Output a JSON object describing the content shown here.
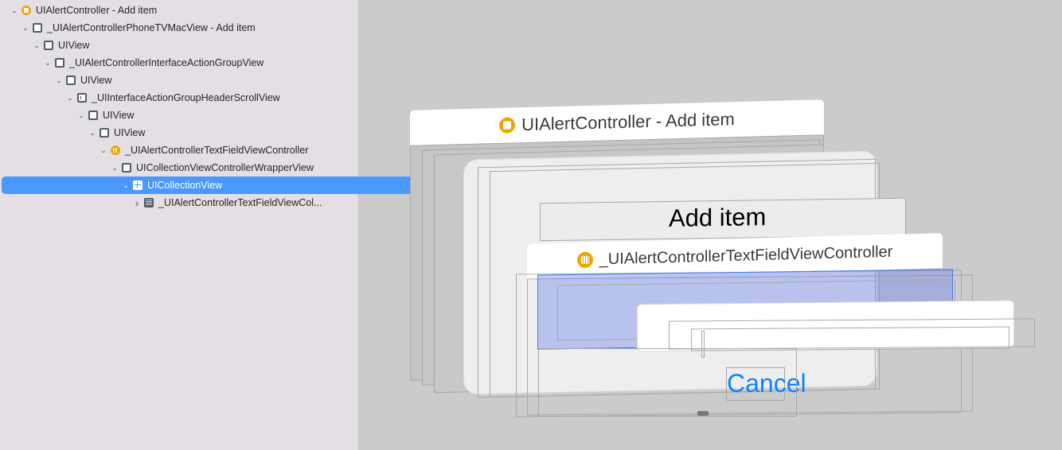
{
  "tree": [
    {
      "label": "UIAlertController - Add item",
      "icon": "view-controller-icon",
      "depth": 0,
      "expanded": true
    },
    {
      "label": "_UIAlertControllerPhoneTVMacView - Add item",
      "icon": "view-icon",
      "depth": 1,
      "expanded": true
    },
    {
      "label": "UIView",
      "icon": "view-icon",
      "depth": 2,
      "expanded": true
    },
    {
      "label": "_UIAlertControllerInterfaceActionGroupView",
      "icon": "view-icon",
      "depth": 3,
      "expanded": true
    },
    {
      "label": "UIView",
      "icon": "view-icon",
      "depth": 4,
      "expanded": true
    },
    {
      "label": "_UIInterfaceActionGroupHeaderScrollView",
      "icon": "scroll-view-icon",
      "depth": 5,
      "expanded": true
    },
    {
      "label": "UIView",
      "icon": "view-icon",
      "depth": 6,
      "expanded": true
    },
    {
      "label": "UIView",
      "icon": "view-icon",
      "depth": 7,
      "expanded": true
    },
    {
      "label": "_UIAlertControllerTextFieldViewController",
      "icon": "collection-view-controller-icon",
      "depth": 8,
      "expanded": true
    },
    {
      "label": "UICollectionViewControllerWrapperView",
      "icon": "view-icon",
      "depth": 9,
      "expanded": true
    },
    {
      "label": "UICollectionView",
      "icon": "collection-view-icon",
      "depth": 10,
      "expanded": true,
      "selected": true
    },
    {
      "label": "_UIAlertControllerTextFieldViewCol...",
      "icon": "collection-cell-icon",
      "depth": 11,
      "expanded": false
    }
  ],
  "canvas": {
    "root_title": "UIAlertController - Add item",
    "alert_title": "Add item",
    "child_title": "_UIAlertControllerTextFieldViewController",
    "cancel_label": "Cancel"
  },
  "colors": {
    "selection": "#4a98fb",
    "accent": "#f0a500",
    "link": "#0a84ff"
  }
}
